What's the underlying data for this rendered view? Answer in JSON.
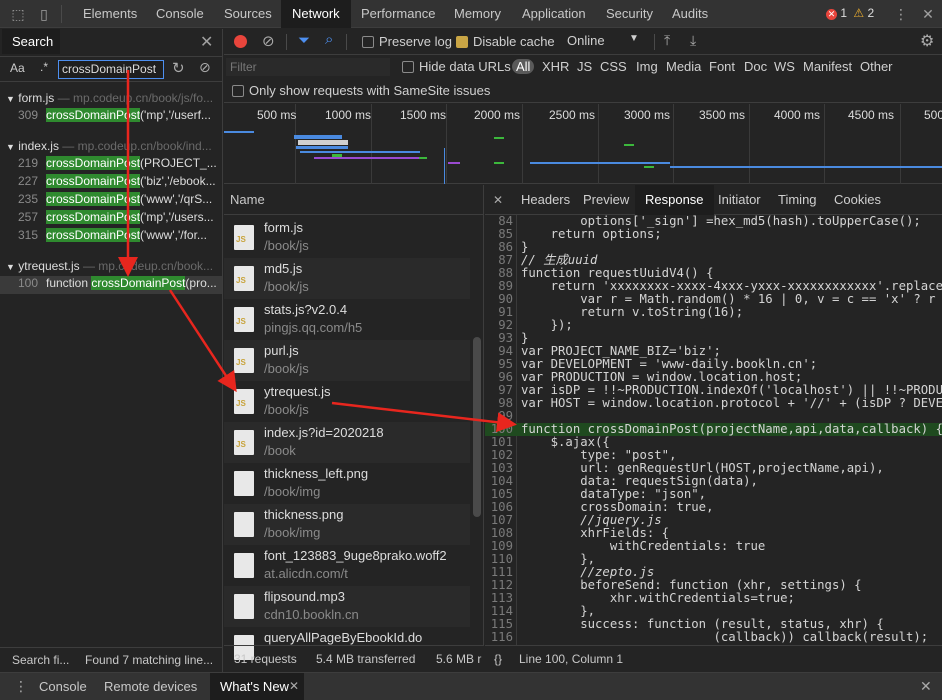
{
  "tabs": [
    "Elements",
    "Console",
    "Sources",
    "Network",
    "Performance",
    "Memory",
    "Application",
    "Security",
    "Audits"
  ],
  "active_tab": "Network",
  "errors": "1",
  "warnings": "2",
  "search": {
    "tab_label": "Search",
    "aa": "Aa",
    "regex": ".*",
    "query": "crossDomainPost",
    "files": [
      {
        "name": "form.js",
        "path": "— mp.codeup.cn/book/js/fo...",
        "matches": [
          {
            "line": "309",
            "pre": "",
            "hit": "crossDomainPost",
            "post": "('mp','/userf..."
          }
        ]
      },
      {
        "name": "index.js",
        "path": "— mp.codeup.cn/book/ind...",
        "matches": [
          {
            "line": "219",
            "pre": "",
            "hit": "crossDomainPost",
            "post": "(PROJECT_..."
          },
          {
            "line": "227",
            "pre": "",
            "hit": "crossDomainPost",
            "post": "('biz','/ebook..."
          },
          {
            "line": "235",
            "pre": "",
            "hit": "crossDomainPost",
            "post": "('www','/qrS..."
          },
          {
            "line": "257",
            "pre": "",
            "hit": "crossDomainPost",
            "post": "('mp','/users..."
          },
          {
            "line": "315",
            "pre": "",
            "hit": "crossDomainPost",
            "post": "('www','/for..."
          }
        ]
      },
      {
        "name": "ytrequest.js",
        "path": "— mp.codeup.cn/book...",
        "matches": [
          {
            "line": "100",
            "pre": "function ",
            "hit": "crossDomainPost",
            "post": "(pro..."
          }
        ]
      }
    ],
    "footer_left": "Search fi...",
    "footer_right": "Found 7 matching line..."
  },
  "toolbar": {
    "preserve_log": "Preserve log",
    "disable_cache": "Disable cache",
    "throttle": "Online"
  },
  "filter": {
    "placeholder": "Filter",
    "hide_data_urls": "Hide data URLs",
    "types": [
      "All",
      "XHR",
      "JS",
      "CSS",
      "Img",
      "Media",
      "Font",
      "Doc",
      "WS",
      "Manifest",
      "Other"
    ],
    "samesite": "Only show requests with SameSite issues"
  },
  "timeline_ticks": [
    "500 ms",
    "1000 ms",
    "1500 ms",
    "2000 ms",
    "2500 ms",
    "3000 ms",
    "3500 ms",
    "4000 ms",
    "4500 ms",
    "500"
  ],
  "requests": {
    "header": "Name",
    "rows": [
      {
        "name": "form.js",
        "path": "/book/js",
        "icon": "js-file-icon"
      },
      {
        "name": "md5.js",
        "path": "/book/js",
        "icon": "js-file-icon"
      },
      {
        "name": "stats.js?v2.0.4",
        "path": "pingjs.qq.com/h5",
        "icon": "js-file-icon"
      },
      {
        "name": "purl.js",
        "path": "/book/js",
        "icon": "js-file-icon"
      },
      {
        "name": "ytrequest.js",
        "path": "/book/js",
        "icon": "js-file-icon"
      },
      {
        "name": "index.js?id=2020218",
        "path": "/book",
        "icon": "js-file-icon"
      },
      {
        "name": "thickness_left.png",
        "path": "/book/img",
        "icon": "image-file-icon"
      },
      {
        "name": "thickness.png",
        "path": "/book/img",
        "icon": "image-file-icon"
      },
      {
        "name": "font_123883_9uge8prako.woff2",
        "path": "at.alicdn.com/t",
        "icon": "font-file-icon"
      },
      {
        "name": "flipsound.mp3",
        "path": "cdn10.bookln.cn",
        "icon": "media-file-icon"
      },
      {
        "name": "queryAllPageByEbookId.do",
        "path": "",
        "icon": "doc-file-icon"
      }
    ]
  },
  "response_tabs": [
    "Headers",
    "Preview",
    "Response",
    "Initiator",
    "Timing",
    "Cookies"
  ],
  "active_response_tab": "Response",
  "code_lines": [
    {
      "n": "84",
      "t": "        options['_sign'] =hex_md5(hash).toUpperCase();"
    },
    {
      "n": "85",
      "t": "    return options;"
    },
    {
      "n": "86",
      "t": "}"
    },
    {
      "n": "87",
      "t": "// 生成uuid"
    },
    {
      "n": "88",
      "t": "function requestUuidV4() {"
    },
    {
      "n": "89",
      "t": "    return 'xxxxxxxx-xxxx-4xxx-yxxx-xxxxxxxxxxxx'.replace(/"
    },
    {
      "n": "90",
      "t": "        var r = Math.random() * 16 | 0, v = c == 'x' ? r :"
    },
    {
      "n": "91",
      "t": "        return v.toString(16);"
    },
    {
      "n": "92",
      "t": "    });"
    },
    {
      "n": "93",
      "t": "}"
    },
    {
      "n": "94",
      "t": "var PROJECT_NAME_BIZ='biz';"
    },
    {
      "n": "95",
      "t": "var DEVELOPMENT = 'www-daily.bookln.cn';"
    },
    {
      "n": "96",
      "t": "var PRODUCTION = window.location.host;"
    },
    {
      "n": "97",
      "t": "var isDP = !!~PRODUCTION.indexOf('localhost') || !!~PRODUCT"
    },
    {
      "n": "98",
      "t": "var HOST = window.location.protocol + '//' + (isDP ? DEVEL"
    },
    {
      "n": "99",
      "t": ""
    },
    {
      "n": "100",
      "t": "function crossDomainPost(projectName,api,data,callback) {"
    },
    {
      "n": "101",
      "t": "    $.ajax({"
    },
    {
      "n": "102",
      "t": "        type: \"post\","
    },
    {
      "n": "103",
      "t": "        url: genRequestUrl(HOST,projectName,api),"
    },
    {
      "n": "104",
      "t": "        data: requestSign(data),"
    },
    {
      "n": "105",
      "t": "        dataType: \"json\","
    },
    {
      "n": "106",
      "t": "        crossDomain: true,"
    },
    {
      "n": "107",
      "t": "        //jquery.js"
    },
    {
      "n": "108",
      "t": "        xhrFields: {"
    },
    {
      "n": "109",
      "t": "            withCredentials: true"
    },
    {
      "n": "110",
      "t": "        },"
    },
    {
      "n": "111",
      "t": "        //zepto.js"
    },
    {
      "n": "112",
      "t": "        beforeSend: function (xhr, settings) {"
    },
    {
      "n": "113",
      "t": "            xhr.withCredentials=true;"
    },
    {
      "n": "114",
      "t": "        },"
    },
    {
      "n": "115",
      "t": "        success: function (result, status, xhr) {"
    },
    {
      "n": "116",
      "t": "                          (callback)) callback(result);"
    }
  ],
  "status": {
    "requests": "31 requests",
    "transferred": "5.4 MB transferred",
    "resources": "5.6 MB r",
    "braces": "{}",
    "position": "Line 100, Column 1"
  },
  "drawer": {
    "tabs": [
      "Console",
      "Remote devices",
      "What's New"
    ],
    "active": "What's New"
  },
  "colors": {
    "highlight": "#2f8a2f",
    "annotation_arrow": "#e8261e",
    "record": "#e8453c"
  }
}
